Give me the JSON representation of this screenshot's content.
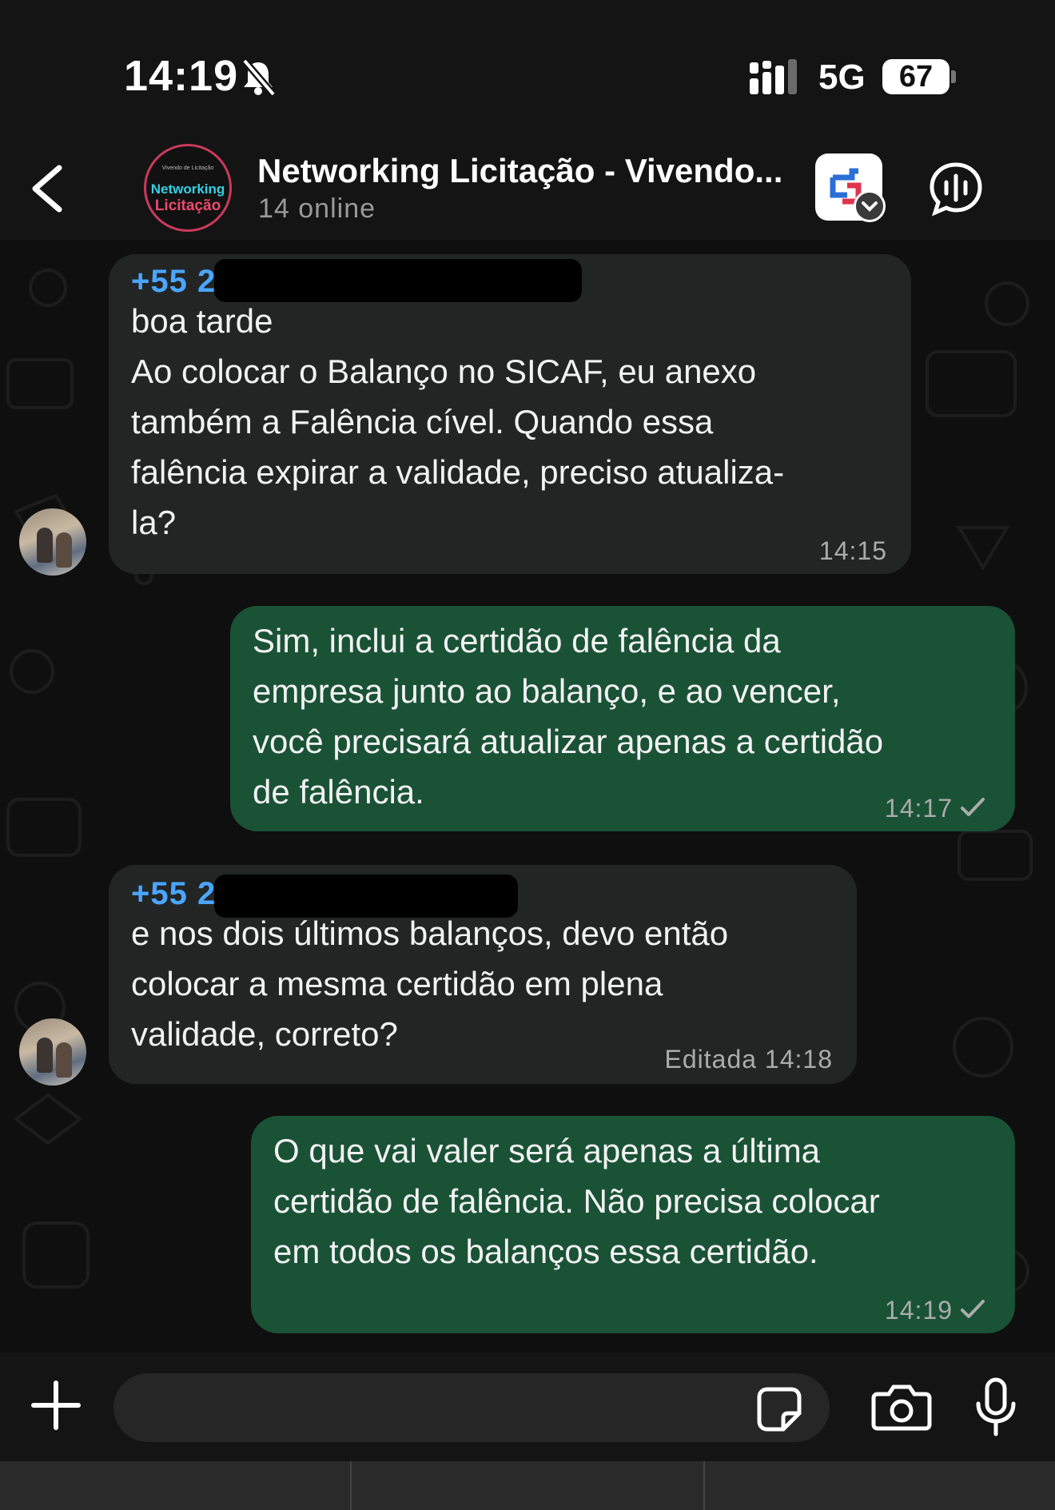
{
  "status_bar": {
    "time": "14:19",
    "network": "5G",
    "battery": "67",
    "icons": [
      "bell-off-icon",
      "signal-icon",
      "battery-icon"
    ]
  },
  "header": {
    "title": "Networking Licitação - Vivendo...",
    "subtitle": "14 online",
    "avatar_line1": "Networking",
    "avatar_line2": "Licitação",
    "avatar_top": "Vivendo de Licitação",
    "icons": [
      "back-icon",
      "app-badge-icon",
      "voice-call-icon"
    ]
  },
  "messages": [
    {
      "direction": "incoming",
      "sender": "+55 22",
      "text": "boa tarde\nAo colocar o Balanço no SICAF, eu anexo\ntambém a Falência cível. Quando essa\nfalência expirar a validade, preciso atualiza-\nla?",
      "time": "14:15"
    },
    {
      "direction": "outgoing",
      "text": "Sim, inclui a certidão de falência da\nempresa junto ao balanço, e ao vencer,\nvocê precisará atualizar apenas a certidão\nde falência.",
      "time": "14:17",
      "status": "sent"
    },
    {
      "direction": "incoming",
      "sender": "+55 22",
      "text": "e nos dois últimos balanços, devo então\ncolocar a mesma certidão em plena\nvalidade, correto?",
      "edited_label": "Editada",
      "time": "14:18"
    },
    {
      "direction": "outgoing",
      "text": "O que vai valer será apenas a última\ncertidão de falência. Não precisa colocar\nem todos os balanços essa certidão.",
      "time": "14:19",
      "status": "sent"
    }
  ],
  "input": {
    "placeholder": "",
    "icons": [
      "plus-icon",
      "sticker-icon",
      "camera-icon",
      "microphone-icon"
    ]
  },
  "colors": {
    "incoming_bubble": "#232525",
    "outgoing_bubble": "#1a5236",
    "sender_name": "#4aa6ff",
    "background": "#0b0b0b"
  }
}
